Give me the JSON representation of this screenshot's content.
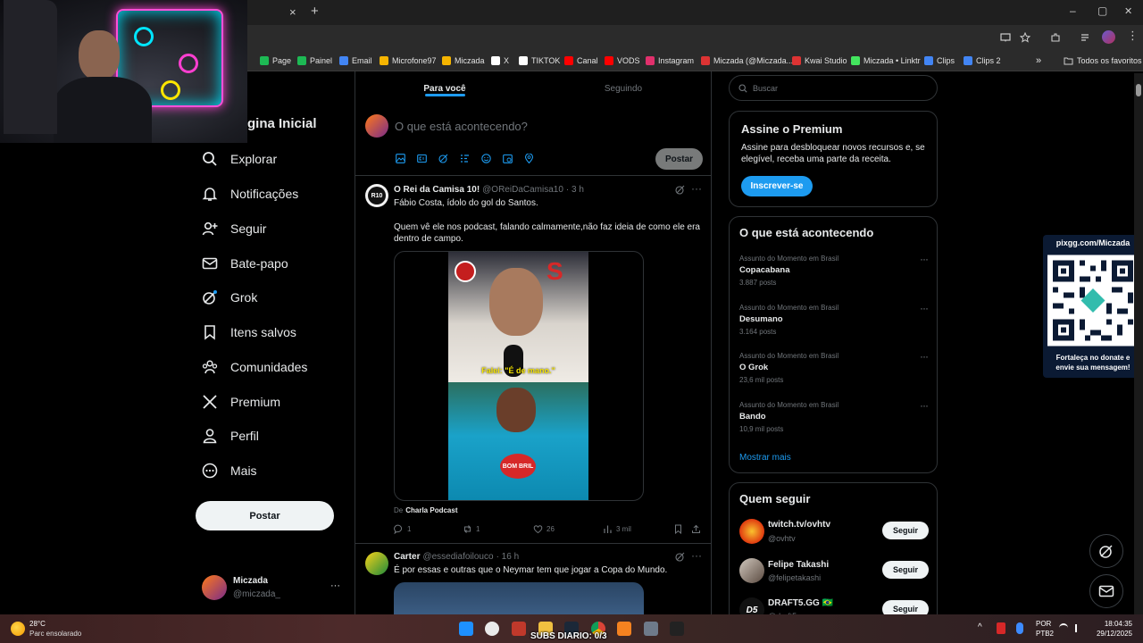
{
  "browser": {
    "tab_close": "×",
    "new_tab": "+",
    "window": {
      "minimize": "–",
      "maximize": "▢",
      "close": "✕"
    },
    "bookmarks": [
      {
        "label": "Page",
        "color": "#1db954"
      },
      {
        "label": "Painel",
        "color": "#1db954"
      },
      {
        "label": "Email",
        "color": "#4285f4"
      },
      {
        "label": "Microfone97",
        "color": "#f5b400"
      },
      {
        "label": "Miczada",
        "color": "#f5b400"
      },
      {
        "label": "X",
        "color": "#ffffff"
      },
      {
        "label": "TIKTOK",
        "color": "#ffffff"
      },
      {
        "label": "Canal",
        "color": "#ff0000"
      },
      {
        "label": "VODS",
        "color": "#ff0000"
      },
      {
        "label": "Instagram",
        "color": "#e1306c"
      },
      {
        "label": "Miczada (@Miczada...",
        "color": "#d33"
      },
      {
        "label": "Kwai Studio",
        "color": "#d33"
      },
      {
        "label": "Miczada • Linktr",
        "color": "#43e55e"
      },
      {
        "label": "Clips",
        "color": "#4285f4"
      },
      {
        "label": "Clips 2",
        "color": "#4285f4"
      }
    ],
    "bookmarks_overflow": "»",
    "all_bookmarks": "Todos os favoritos"
  },
  "nav": {
    "home_partial": "gina Inicial",
    "items": [
      {
        "label": "Explorar",
        "icon": "search-icon"
      },
      {
        "label": "Notificações",
        "icon": "bell-icon"
      },
      {
        "label": "Seguir",
        "icon": "person-plus-icon"
      },
      {
        "label": "Bate-papo",
        "icon": "mail-icon"
      },
      {
        "label": "Grok",
        "icon": "grok-icon"
      },
      {
        "label": "Itens salvos",
        "icon": "bookmark-icon"
      },
      {
        "label": "Comunidades",
        "icon": "people-icon"
      },
      {
        "label": "Premium",
        "icon": "x-logo-icon"
      },
      {
        "label": "Perfil",
        "icon": "person-icon"
      },
      {
        "label": "Mais",
        "icon": "more-circle-icon"
      }
    ],
    "post_button": "Postar",
    "account": {
      "name": "Miczada",
      "handle": "@miczada_",
      "more": "···"
    }
  },
  "feed": {
    "tabs": {
      "for_you": "Para você",
      "following": "Seguindo"
    },
    "composer": {
      "placeholder": "O que está acontecendo?",
      "post_button": "Postar"
    },
    "tweets": [
      {
        "author": "O Rei da Camisa 10!",
        "handle": "@OReiDaCamisa10",
        "time": "· 3 h",
        "avatar_text": "R10",
        "line1": "Fábio Costa, ídolo do gol do Santos.",
        "line2": "Quem vê ele nos podcast, falando calmamente,não faz ideia de como ele era",
        "line3": "dentro de campo.",
        "media_caption": "Falei: \"É de mano.\"",
        "media_shirt": "BOM BRIL",
        "source_prefix": "De",
        "source": "Charla Podcast",
        "replies": "1",
        "reposts": "1",
        "likes": "26",
        "views": "3 mil"
      },
      {
        "author": "Carter",
        "handle": "@essediafoilouco",
        "time": "· 16 h",
        "line1": "É por essas e outras que o Neymar tem que jogar a Copa do Mundo."
      }
    ]
  },
  "sidebar": {
    "search_placeholder": "Buscar",
    "premium": {
      "title": "Assine o Premium",
      "text1": "Assine para desbloquear novos recursos e, se",
      "text2": "elegível, receba uma parte da receita.",
      "button": "Inscrever-se"
    },
    "trends": {
      "title": "O que está acontecendo",
      "items": [
        {
          "category": "Assunto do Momento em Brasil",
          "name": "Copacabana",
          "count": "3.887 posts"
        },
        {
          "category": "Assunto do Momento em Brasil",
          "name": "Desumano",
          "count": "3.164 posts"
        },
        {
          "category": "Assunto do Momento em Brasil",
          "name": "O Grok",
          "count": "23,6 mil posts"
        },
        {
          "category": "Assunto do Momento em Brasil",
          "name": "Bando",
          "count": "10,9 mil posts"
        }
      ],
      "more": "Mostrar mais"
    },
    "who_to_follow": {
      "title": "Quem seguir",
      "items": [
        {
          "name": "twitch.tv/ovhtv",
          "handle": "@ovhtv",
          "button": "Seguir"
        },
        {
          "name": "Felipe Takashi",
          "handle": "@felipetakashi",
          "button": "Seguir"
        },
        {
          "name": "DRAFT5.GG 🇧🇷",
          "handle": "@draft5gg",
          "button": "Seguir",
          "avatar_text": "D5"
        }
      ]
    }
  },
  "pix": {
    "title": "pixgg.com/Miczada",
    "footer1": "Fortaleça no donate e",
    "footer2": "envie sua mensagem!"
  },
  "taskbar": {
    "weather_temp": "28°C",
    "weather_desc": "Parc ensolarado",
    "overlay_text": "SUBS DIARIO: 0/3",
    "lang1": "POR",
    "lang2": "PTB2",
    "time": "18:04:35",
    "date": "29/12/2025"
  },
  "colors": {
    "accent": "#1d9bf0",
    "background": "#000000",
    "border": "#2f3336",
    "muted": "#71767b"
  }
}
